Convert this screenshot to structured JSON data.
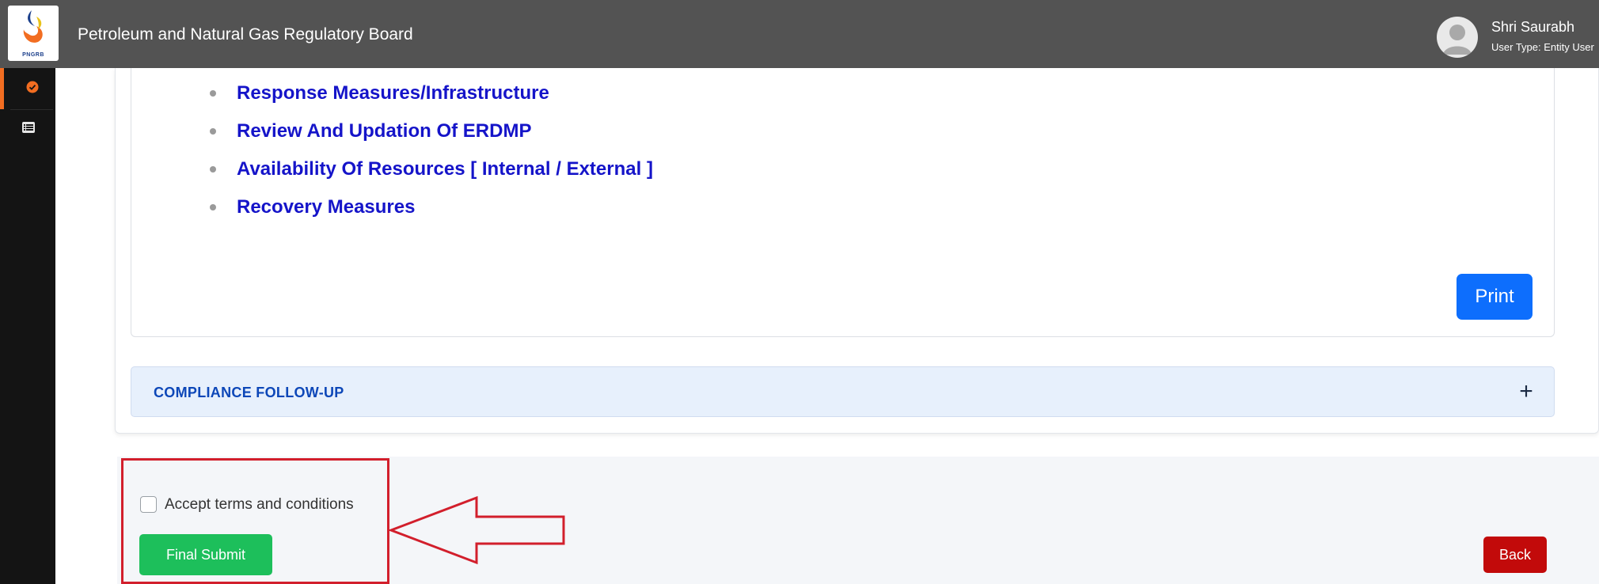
{
  "header": {
    "logo_text": "PNGRB",
    "app_title": "Petroleum and Natural Gas Regulatory Board",
    "user_name": "Shri Saurabh",
    "user_type": "User Type: Entity User"
  },
  "sidebar": {
    "items": [
      {
        "icon": "check-circle-icon",
        "active": true
      },
      {
        "icon": "list-icon",
        "active": false
      }
    ]
  },
  "content": {
    "bullets": [
      "Response Measures/Infrastructure",
      "Review And Updation Of ERDMP",
      "Availability Of Resources [ Internal / External ]",
      "Recovery Measures"
    ],
    "print_label": "Print"
  },
  "accordion": {
    "title": "COMPLIANCE FOLLOW-UP",
    "toggle": "+"
  },
  "footer": {
    "terms_label": "Accept terms and conditions",
    "terms_checked": false,
    "final_submit_label": "Final Submit",
    "back_label": "Back"
  },
  "colors": {
    "header_bg": "#535353",
    "sidebar_bg": "#141414",
    "sidebar_active": "#f26d21",
    "bullet_text": "#1514c9",
    "print_button": "#0d6efd",
    "accordion_bg": "#e7f0fc",
    "final_submit": "#1dbf5b",
    "back_button": "#c20a0a",
    "annotation": "#d21f2c"
  }
}
